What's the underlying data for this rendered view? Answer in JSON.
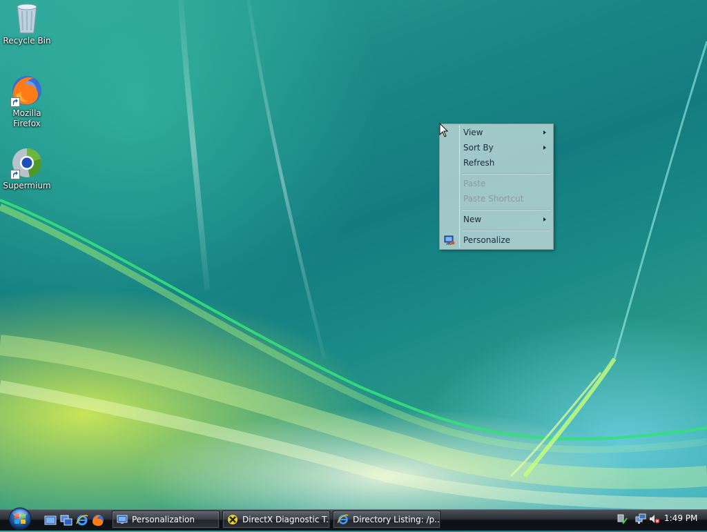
{
  "desktop": {
    "icons": [
      {
        "label": "Recycle Bin",
        "icon": "recycle-bin-icon"
      },
      {
        "label": "Mozilla\nFirefox",
        "icon": "firefox-icon"
      },
      {
        "label": "Supermium",
        "icon": "supermium-icon"
      }
    ]
  },
  "context_menu": {
    "items": [
      {
        "label": "View",
        "submenu": true,
        "enabled": true
      },
      {
        "label": "Sort By",
        "submenu": true,
        "enabled": true
      },
      {
        "label": "Refresh",
        "submenu": false,
        "enabled": true
      },
      {
        "label": "Paste",
        "submenu": false,
        "enabled": false
      },
      {
        "label": "Paste Shortcut",
        "submenu": false,
        "enabled": false
      },
      {
        "label": "New",
        "submenu": true,
        "enabled": true
      },
      {
        "label": "Personalize",
        "submenu": false,
        "enabled": true,
        "icon": "personalize-icon"
      }
    ]
  },
  "taskbar": {
    "start_button": "start-orb-icon",
    "quick_launch": [
      "show-desktop-icon",
      "switch-windows-icon",
      "internet-explorer-icon",
      "firefox-icon"
    ],
    "tasks": [
      {
        "label": "Personalization",
        "icon": "personalization-monitor-icon"
      },
      {
        "label": "DirectX Diagnostic T...",
        "icon": "directx-icon"
      },
      {
        "label": "Directory Listing: /p...",
        "icon": "internet-explorer-icon"
      }
    ],
    "tray": {
      "icons": [
        "safely-remove-hardware-icon",
        "network-icon",
        "volume-muted-icon"
      ],
      "clock": "1:49 PM"
    }
  },
  "colors": {
    "accent": "#1c8a86",
    "menu_text": "#1b2a3a",
    "menu_disabled_text": "#8b9aa0"
  }
}
